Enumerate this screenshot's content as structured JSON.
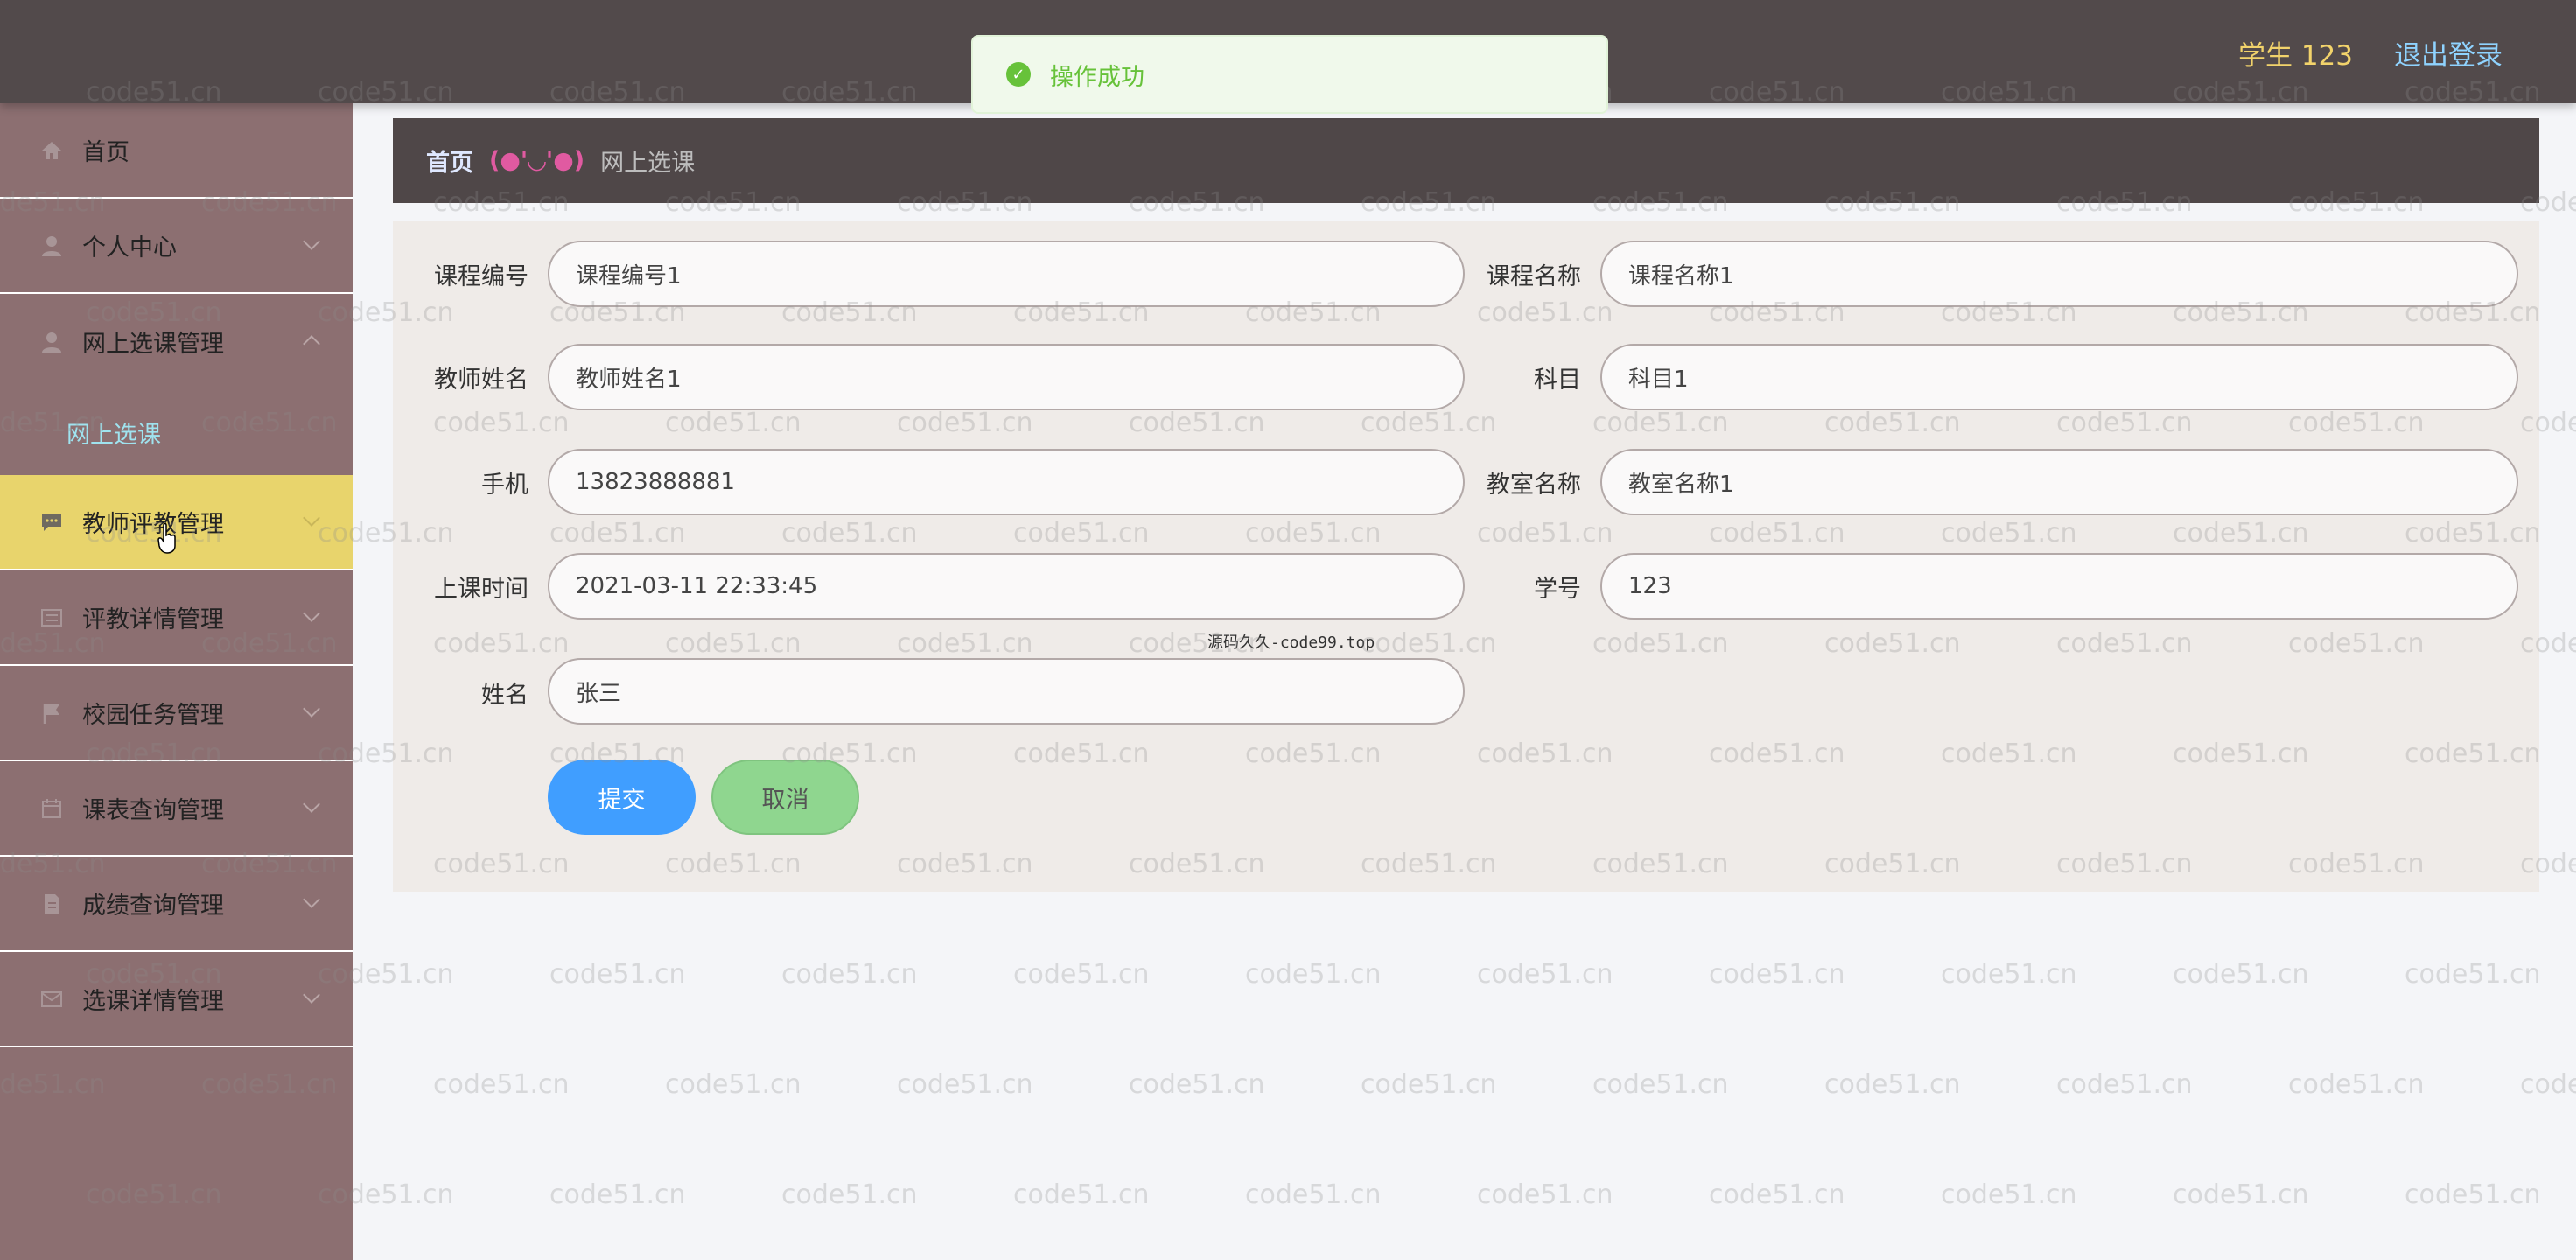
{
  "header": {
    "user_label": "学生 123",
    "logout_label": "退出登录"
  },
  "toast": {
    "message": "操作成功",
    "icon": "check-circle-icon"
  },
  "sidebar": {
    "items": [
      {
        "label": "首页",
        "icon": "home-icon"
      },
      {
        "label": "个人中心",
        "icon": "user-icon"
      },
      {
        "label": "网上选课管理",
        "icon": "user-icon"
      },
      {
        "label": "网上选课",
        "sub": true
      },
      {
        "label": "教师评教管理",
        "icon": "chat-icon",
        "active": true
      },
      {
        "label": "评教详情管理",
        "icon": "list-icon"
      },
      {
        "label": "校园任务管理",
        "icon": "flag-icon"
      },
      {
        "label": "课表查询管理",
        "icon": "calendar-icon"
      },
      {
        "label": "成绩查询管理",
        "icon": "document-icon"
      },
      {
        "label": "选课详情管理",
        "icon": "mail-icon"
      }
    ]
  },
  "breadcrumb": {
    "home": "首页",
    "separator": "(●'◡'●)",
    "current": "网上选课"
  },
  "form": {
    "course_no": {
      "label": "课程编号",
      "value": "课程编号1"
    },
    "course_name": {
      "label": "课程名称",
      "value": "课程名称1"
    },
    "teacher_name": {
      "label": "教师姓名",
      "value": "教师姓名1"
    },
    "subject": {
      "label": "科目",
      "value": "科目1"
    },
    "phone": {
      "label": "手机",
      "value": "13823888881"
    },
    "classroom": {
      "label": "教室名称",
      "value": "教室名称1"
    },
    "class_time": {
      "label": "上课时间",
      "value": "2021-03-11 22:33:45"
    },
    "student_no": {
      "label": "学号",
      "value": "123"
    },
    "name": {
      "label": "姓名",
      "value": "张三"
    },
    "submit_label": "提交",
    "cancel_label": "取消"
  },
  "watermark": {
    "text": "code51.cn",
    "center_text": "源码久久-code99.top"
  },
  "colors": {
    "header_bg": "#524a4b",
    "sidebar_bg": "#8c6f71",
    "active_item_bg": "#e8d46c",
    "submit_bg": "#409eff",
    "cancel_bg": "#8fd68f",
    "toast_success": "#67c23a"
  }
}
